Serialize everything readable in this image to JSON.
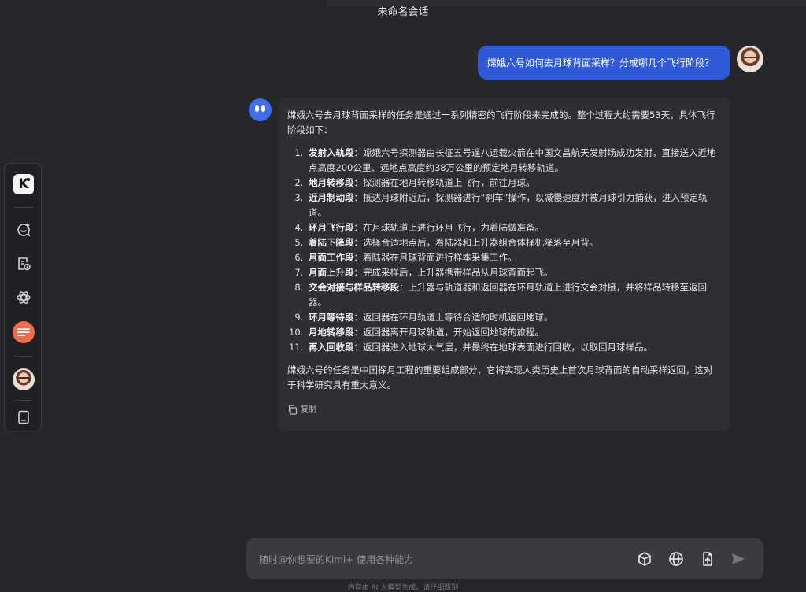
{
  "header": {
    "title": "未命名会话"
  },
  "sidebar": {
    "logo": "K",
    "icons": [
      "new-chat-icon",
      "history-icon",
      "explore-icon",
      "orange-app-icon",
      "user-avatar",
      "tablet-icon"
    ]
  },
  "conversation": {
    "user_message": "嫦娥六号如何去月球背面采样？分成哪几个飞行阶段？",
    "bot": {
      "intro": "嫦娥六号去月球背面采样的任务是通过一系列精密的飞行阶段来完成的。整个过程大约需要53天，具体飞行阶段如下：",
      "steps": [
        {
          "title": "发射入轨段",
          "text": "：嫦娥六号探测器由长征五号遥八运载火箭在中国文昌航天发射场成功发射，直接送入近地点高度200公里、远地点高度约38万公里的预定地月转移轨道。"
        },
        {
          "title": "地月转移段",
          "text": "：探测器在地月转移轨道上飞行，前往月球。"
        },
        {
          "title": "近月制动段",
          "text": "：抵达月球附近后，探测器进行“刹车”操作，以减慢速度并被月球引力捕获，进入预定轨道。"
        },
        {
          "title": "环月飞行段",
          "text": "：在月球轨道上进行环月飞行，为着陆做准备。"
        },
        {
          "title": "着陆下降段",
          "text": "：选择合适地点后，着陆器和上升器组合体择机降落至月背。"
        },
        {
          "title": "月面工作段",
          "text": "：着陆器在月球背面进行样本采集工作。"
        },
        {
          "title": "月面上升段",
          "text": "：完成采样后，上升器携带样品从月球背面起飞。"
        },
        {
          "title": "交会对接与样品转移段",
          "text": "：上升器与轨道器和返回器在环月轨道上进行交会对接，并将样品转移至返回器。"
        },
        {
          "title": "环月等待段",
          "text": "：返回器在环月轨道上等待合适的时机返回地球。"
        },
        {
          "title": "月地转移段",
          "text": "：返回器离开月球轨道，开始返回地球的旅程。"
        },
        {
          "title": "再入回收段",
          "text": "：返回器进入地球大气层，并最终在地球表面进行回收，以取回月球样品。"
        }
      ],
      "conclusion": "嫦娥六号的任务是中国探月工程的重要组成部分，它将实现人类历史上首次月球背面的自动采样返回，这对于科学研究具有重大意义。",
      "copy_label": "复制"
    }
  },
  "composer": {
    "placeholder": "随时@你想要的Kimi+ 使用各种能力",
    "value": ""
  },
  "footer": {
    "note": "内容由 AI 大模型生成，请仔细甄别"
  },
  "colors": {
    "background": "#26272b",
    "user_bubble": "#2f59d6",
    "bot_bubble": "#2e2f34",
    "accent_orange": "#f26b4b",
    "bot_avatar": "#3e6df0"
  }
}
